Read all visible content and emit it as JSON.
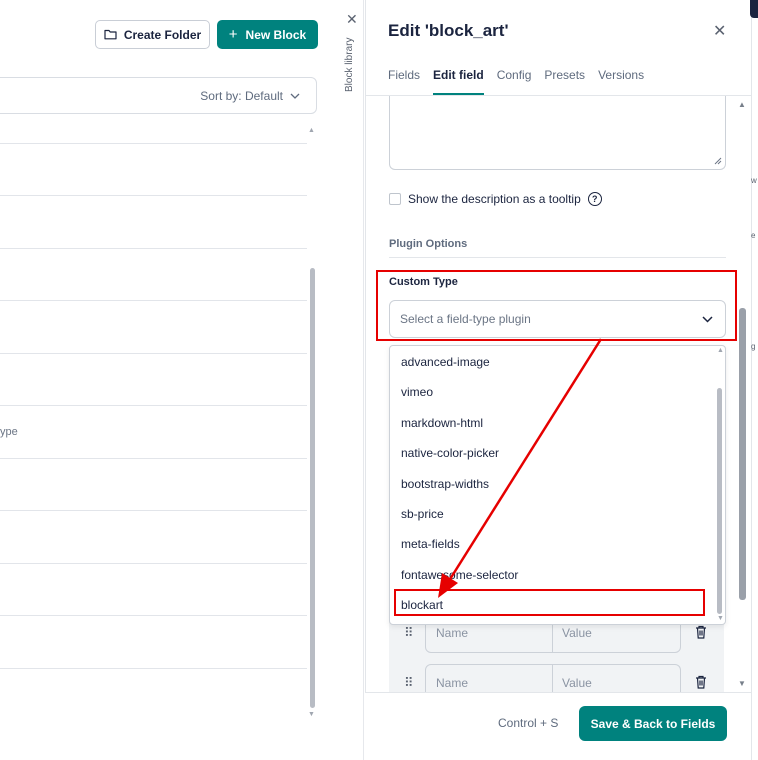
{
  "library": {
    "create_folder_label": "Create Folder",
    "new_block_label": "New Block",
    "sort_label": "Sort by: Default",
    "partial_row_text": "ype"
  },
  "strip": {
    "label": "Block library"
  },
  "panel": {
    "title": "Edit 'block_art'",
    "tabs": [
      {
        "label": "Fields",
        "active": false
      },
      {
        "label": "Edit field",
        "active": true
      },
      {
        "label": "Config",
        "active": false
      },
      {
        "label": "Presets",
        "active": false
      },
      {
        "label": "Versions",
        "active": false
      }
    ],
    "tooltip_checkbox_label": "Show the description as a tooltip",
    "plugin_options_header": "Plugin Options",
    "custom_type_label": "Custom Type",
    "select_placeholder": "Select a field-type plugin",
    "plugin_options": [
      "advanced-image",
      "vimeo",
      "markdown-html",
      "native-color-picker",
      "bootstrap-widths",
      "sb-price",
      "meta-fields",
      "fontawesome-selector",
      "blockart"
    ],
    "option_rows": [
      {
        "name_placeholder": "Name",
        "value_placeholder": "Value"
      },
      {
        "name_placeholder": "Name",
        "value_placeholder": "Value"
      }
    ],
    "shortcut_hint": "Control + S",
    "save_label": "Save & Back to Fields"
  },
  "edge_fragments": [
    "w",
    "e",
    "g"
  ],
  "colors": {
    "accent": "#00827e",
    "annotation": "#e60000",
    "text": "#1b243f"
  }
}
